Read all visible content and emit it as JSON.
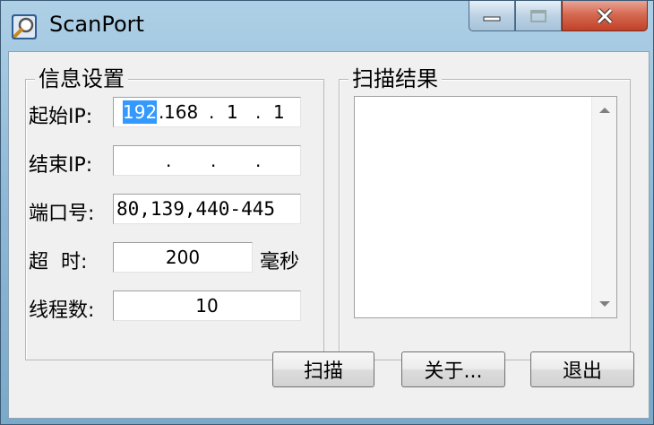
{
  "window": {
    "title": "ScanPort"
  },
  "info_group": {
    "legend": "信息设置",
    "start_ip": {
      "label": "起始IP:",
      "octets": [
        "192",
        "168",
        "1",
        "1"
      ]
    },
    "end_ip": {
      "label": "结束IP:",
      "octets": [
        "",
        "",
        "",
        ""
      ]
    },
    "port": {
      "label": "端口号:",
      "value": "80,139,440-445"
    },
    "timeout": {
      "label": "超  时:",
      "value": "200",
      "unit": "毫秒"
    },
    "threads": {
      "label": "线程数:",
      "value": "10"
    }
  },
  "result_group": {
    "legend": "扫描结果",
    "items": []
  },
  "buttons": {
    "scan": "扫描",
    "about": "关于...",
    "exit": "退出"
  },
  "colors": {
    "selection": "#3399ff",
    "close_button": "#c24028"
  }
}
